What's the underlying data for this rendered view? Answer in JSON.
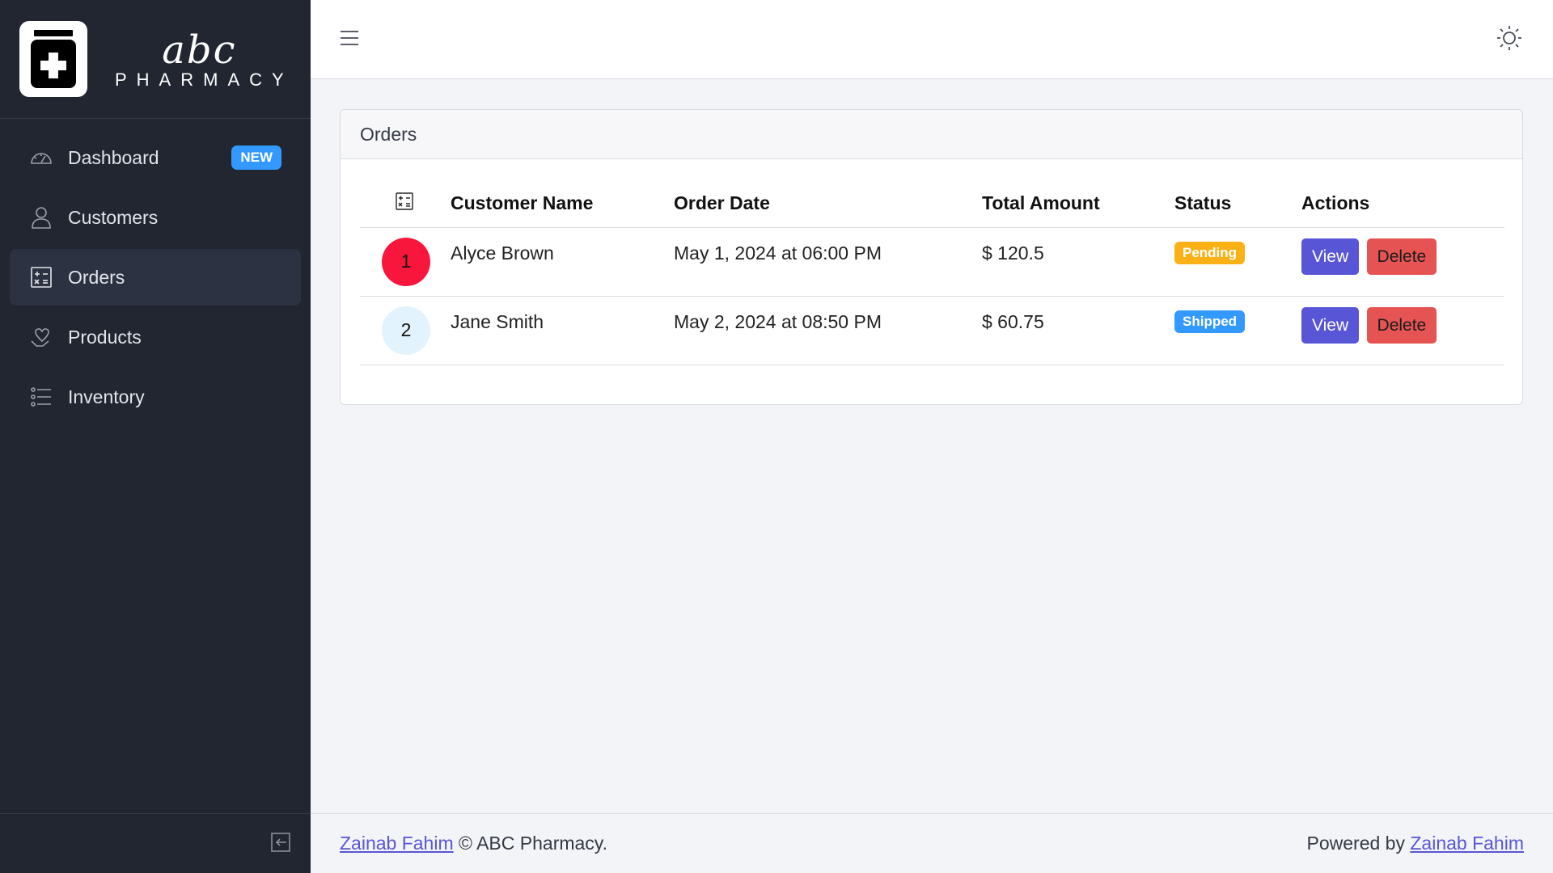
{
  "brand": {
    "script_text": "abc",
    "name_text": "PHARMACY"
  },
  "sidebar": {
    "items": [
      {
        "label": "Dashboard",
        "icon": "speedometer-icon",
        "badge": "NEW",
        "active": false
      },
      {
        "label": "Customers",
        "icon": "user-icon",
        "active": false
      },
      {
        "label": "Orders",
        "icon": "calculator-icon",
        "active": true
      },
      {
        "label": "Products",
        "icon": "heart-hand-icon",
        "active": false
      },
      {
        "label": "Inventory",
        "icon": "list-icon",
        "active": false
      }
    ],
    "footer_icon": "collapse-sidebar-icon"
  },
  "header": {
    "menu_icon": "hamburger-menu-icon",
    "theme_icon": "sun-icon"
  },
  "orders": {
    "title": "Orders",
    "columns": {
      "index_icon": "calculator-icon",
      "customer": "Customer Name",
      "date": "Order Date",
      "total": "Total Amount",
      "status": "Status",
      "actions": "Actions"
    },
    "rows": [
      {
        "index": "1",
        "customer": "Alyce Brown",
        "date": "May 1, 2024 at 06:00 PM",
        "total": "$ 120.5",
        "status": "Pending",
        "view": "View",
        "delete": "Delete"
      },
      {
        "index": "2",
        "customer": "Jane Smith",
        "date": "May 2, 2024 at 08:50 PM",
        "total": "$ 60.75",
        "status": "Shipped",
        "view": "View",
        "delete": "Delete"
      }
    ]
  },
  "footer": {
    "author_link": "Zainab Fahim",
    "copyright": "© ABC Pharmacy.",
    "powered_by": "Powered by",
    "powered_link": "Zainab Fahim"
  },
  "colors": {
    "sidebar_bg": "#212631",
    "accent": "#5856d6",
    "danger": "#e55353",
    "warning": "#f9b115",
    "info": "#3399ff",
    "avatar_1": "#f9163c",
    "avatar_2": "#e3f3fd"
  }
}
